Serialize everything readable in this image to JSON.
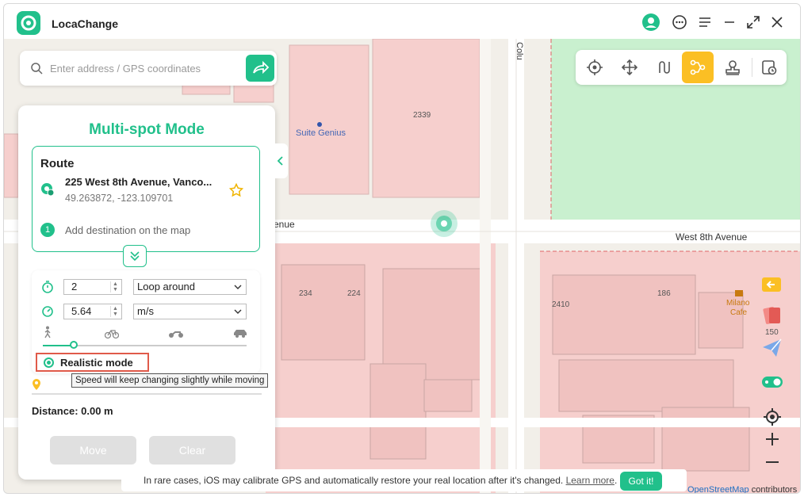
{
  "app": {
    "title": "LocaChange"
  },
  "search": {
    "placeholder": "Enter address / GPS coordinates"
  },
  "panel": {
    "title": "Multi-spot Mode",
    "route_label": "Route",
    "start": {
      "address": "225 West 8th Avenue, Vanco...",
      "coords": "49.263872, -123.109701"
    },
    "destination": {
      "number": "1",
      "text": "Add destination on the map"
    },
    "loops": {
      "value": "2",
      "mode": "Loop around"
    },
    "speed": {
      "value": "5.64",
      "unit": "m/s",
      "slider_fraction": 0.15
    },
    "realistic_mode": {
      "label": "Realistic mode",
      "checked": true,
      "tooltip": "Speed will keep changing slightly while moving"
    },
    "distance": "Distance: 0.00 m",
    "move_label": "Move",
    "clear_label": "Clear"
  },
  "map": {
    "labels": {
      "poi_suite_genius": "Suite Genius",
      "street_avenue_left": "venue",
      "street_west8th": "West 8th Avenue",
      "street_columbia": "Colu",
      "num_2339": "2339",
      "num_234": "234",
      "num_224": "224",
      "num_2410": "2410",
      "num_186": "186",
      "poi_milano": "Milano",
      "poi_cafe": "Cafe",
      "side_150": "150"
    }
  },
  "notice": {
    "text": "In rare cases, iOS may calibrate GPS and automatically restore your real location after it's changed.",
    "link": "Learn more",
    "button": "Got it!"
  },
  "attribution": {
    "link": "OpenStreetMap",
    "suffix": "contributors"
  },
  "colors": {
    "accent": "#21c08b",
    "active_tool": "#fbbf24",
    "building": "#f6cfcd",
    "park": "#c9f0cf"
  }
}
